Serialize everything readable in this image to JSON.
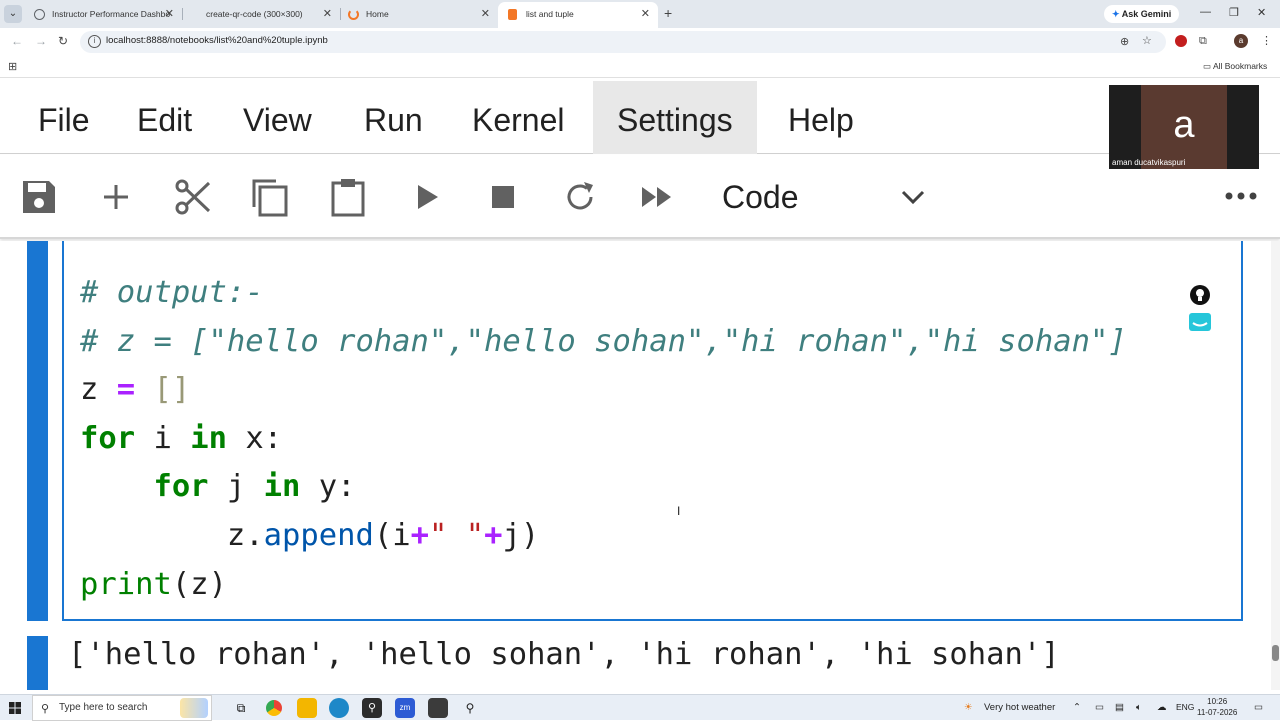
{
  "browser": {
    "tabs": [
      {
        "label": "Instructor Performance Dashbo",
        "active": false,
        "favicon_color": "#5f6368"
      },
      {
        "label": "create-qr-code (300×300)",
        "active": false,
        "favicon_color": ""
      },
      {
        "label": "Home",
        "active": false,
        "favicon_color": "#f37726"
      },
      {
        "label": "list and tuple",
        "active": true,
        "favicon_color": "#f37726"
      }
    ],
    "ask_gemini_label": "Ask Gemini",
    "url": "localhost:8888/notebooks/list%20and%20tuple.ipynb",
    "all_bookmarks_label": "All Bookmarks",
    "profile_initial": "a"
  },
  "jupyter": {
    "menu": [
      "File",
      "Edit",
      "View",
      "Run",
      "Kernel",
      "Settings",
      "Help"
    ],
    "highlighted_menu": "Settings",
    "toolbar": {
      "buttons": [
        "save-icon",
        "add-cell-icon",
        "cut-icon",
        "copy-icon",
        "paste-icon",
        "run-icon",
        "stop-icon",
        "restart-icon",
        "fast-forward-icon"
      ],
      "cell_type": "Code"
    },
    "cell": {
      "code_lines": [
        "# output:-",
        "# z = [\"hello rohan\",\"hello sohan\",\"hi rohan\",\"hi sohan\"]",
        "z = []",
        "for i in x:",
        "    for j in y:",
        "        z.append(i+\" \"+j)",
        "print(z)"
      ]
    },
    "output": "['hello rohan', 'hello sohan', 'hi rohan', 'hi sohan']"
  },
  "video": {
    "initial": "a",
    "name": "aman ducatvikaspuri"
  },
  "taskbar": {
    "search_placeholder": "Type here to search",
    "weather": "Very hot weather",
    "language": "ENG",
    "time": "10:26",
    "date": "11-07-2026"
  }
}
